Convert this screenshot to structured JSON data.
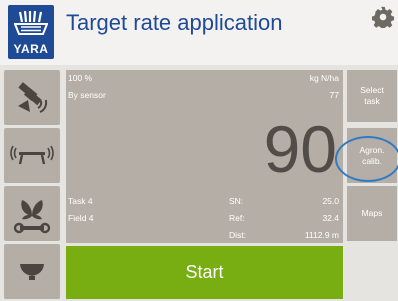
{
  "header": {
    "title": "Target rate application",
    "logo_text": "YARA"
  },
  "left_menu": [
    {
      "icon": "satellite-sensor-icon"
    },
    {
      "icon": "spreader-boom-icon"
    },
    {
      "icon": "plant-wrench-icon"
    },
    {
      "icon": "hopper-icon"
    }
  ],
  "panel": {
    "rate_percent": "100 %",
    "unit": "kg N/ha",
    "mode": "By sensor",
    "sensor_value": "77",
    "target_rate": "90",
    "task": "Task 4",
    "field": "Field 4",
    "sn_label": "SN:",
    "sn_value": "25.0",
    "ref_label": "Ref:",
    "ref_value": "32.4",
    "dist_label": "Dist:",
    "dist_value": "1112.9 m"
  },
  "start_label": "Start",
  "right_menu": {
    "select_task": "Select\ntask",
    "agron_calib": "Agron.\ncalib.",
    "maps": "Maps"
  },
  "colors": {
    "brand_blue": "#1f4a96",
    "start_green": "#78ae12",
    "panel_gray": "#b5aea6",
    "highlight_ring": "#2f7cc4"
  }
}
